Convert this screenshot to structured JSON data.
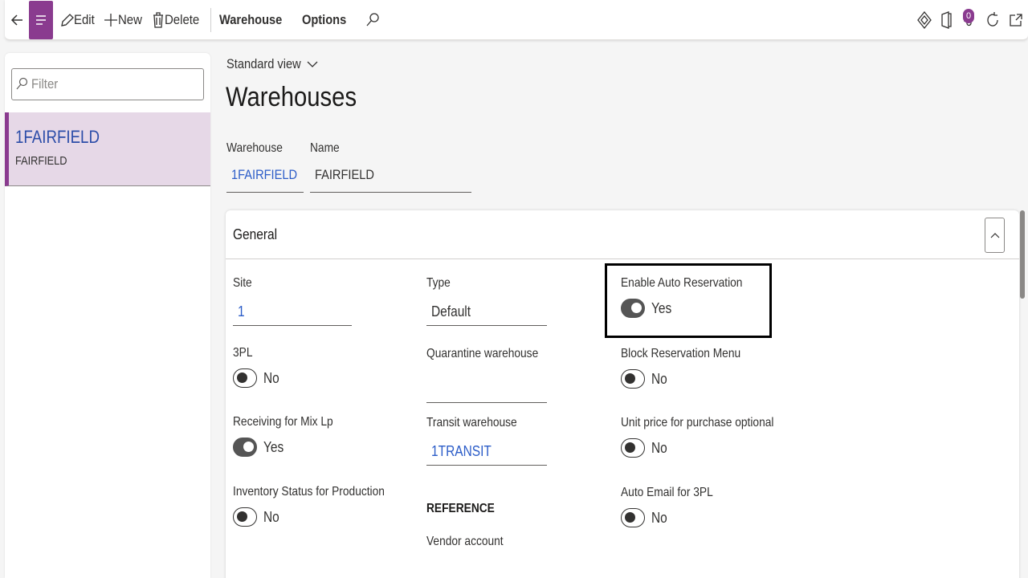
{
  "commandbar": {
    "edit_label": "Edit",
    "new_label": "New",
    "delete_label": "Delete",
    "warehouse_tab": "Warehouse",
    "options_tab": "Options",
    "attachments_count": "0"
  },
  "list": {
    "filter_placeholder": "Filter",
    "items": [
      {
        "title": "1FAIRFIELD",
        "subtitle": "FAIRFIELD"
      }
    ]
  },
  "page": {
    "view": "Standard view",
    "title": "Warehouses"
  },
  "header_fields": {
    "warehouse_label": "Warehouse",
    "warehouse_value": "1FAIRFIELD",
    "name_label": "Name",
    "name_value": "FAIRFIELD"
  },
  "general": {
    "title": "General",
    "col1": {
      "site_label": "Site",
      "site_value": "1",
      "threepl_label": "3PL",
      "threepl_value": "No",
      "mixlp_label": "Receiving for Mix Lp",
      "mixlp_value": "Yes",
      "invstatus_label": "Inventory Status for Production",
      "invstatus_value": "No"
    },
    "col2": {
      "type_label": "Type",
      "type_value": "Default",
      "quarantine_label": "Quarantine warehouse",
      "quarantine_value": "",
      "transit_label": "Transit warehouse",
      "transit_value": "1TRANSIT",
      "reference_header": "REFERENCE",
      "vendor_label": "Vendor account"
    },
    "col3": {
      "autores_label": "Enable Auto Reservation",
      "autores_value": "Yes",
      "blockres_label": "Block Reservation Menu",
      "blockres_value": "No",
      "unitprice_label": "Unit price for purchase optional",
      "unitprice_value": "No",
      "autoemail_label": "Auto Email for 3PL",
      "autoemail_value": "No"
    }
  },
  "colors": {
    "accent": "#8a3b8f",
    "selected_bg": "#e6d8e7",
    "link": "#2b5cc8"
  }
}
